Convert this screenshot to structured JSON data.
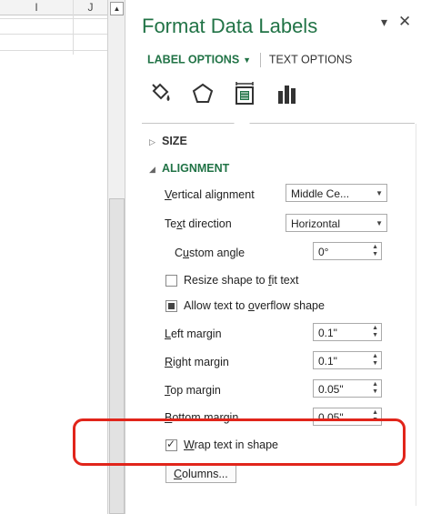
{
  "sheet": {
    "col_headers": [
      "I",
      "J"
    ]
  },
  "pane": {
    "title": "Format Data Labels",
    "dropdown_glyph": "▾",
    "close_glyph": "✕",
    "tabs": {
      "label_options": "LABEL OPTIONS",
      "text_options": "TEXT OPTIONS"
    },
    "icons": [
      "paint-bucket-icon",
      "pentagon-icon",
      "size-properties-icon",
      "bar-chart-icon"
    ],
    "sections": {
      "size": "SIZE",
      "alignment": "ALIGNMENT"
    },
    "fields": {
      "vertical_alignment": {
        "label_pre": "",
        "label_u": "V",
        "label_post": "ertical alignment",
        "value": "Middle Ce..."
      },
      "text_direction": {
        "label_pre": "Te",
        "label_u": "x",
        "label_post": "t direction",
        "value": "Horizontal"
      },
      "custom_angle": {
        "label_pre": "C",
        "label_u": "u",
        "label_post": "stom angle",
        "value": "0°"
      },
      "resize_shape": {
        "label_pre": "Resize shape to ",
        "label_u": "f",
        "label_post": "it text",
        "checked": false
      },
      "allow_overflow": {
        "label_pre": "Allow text to ",
        "label_u": "o",
        "label_post": "verflow shape",
        "checked": true
      },
      "left_margin": {
        "label_pre": "",
        "label_u": "L",
        "label_post": "eft margin",
        "value": "0.1\""
      },
      "right_margin": {
        "label_pre": "",
        "label_u": "R",
        "label_post": "ight margin",
        "value": "0.1\""
      },
      "top_margin": {
        "label_pre": "",
        "label_u": "T",
        "label_post": "op margin",
        "value": "0.05\""
      },
      "bottom_margin": {
        "label_pre": "",
        "label_u": "B",
        "label_post": "ottom margin",
        "value": "0.05\""
      },
      "wrap_text": {
        "label_pre": "",
        "label_u": "W",
        "label_post": "rap text in shape",
        "checked": true
      },
      "columns_button": {
        "label_pre": "",
        "label_u": "C",
        "label_post": "olumns..."
      }
    }
  },
  "colors": {
    "accent": "#217346",
    "highlight": "#e1251b"
  }
}
